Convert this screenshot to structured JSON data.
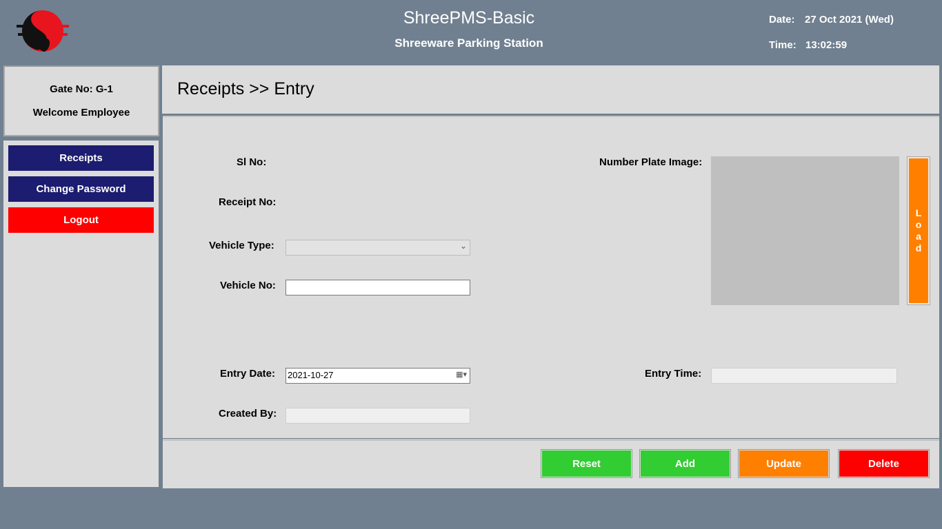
{
  "header": {
    "app_title": "ShreePMS-Basic",
    "subtitle": "Shreeware Parking Station",
    "date_label": "Date:",
    "date_value": "27 Oct 2021 (Wed)",
    "time_label": "Time:",
    "time_value": "13:02:59",
    "logo_icon": "shreeware-logo-icon"
  },
  "sidebar": {
    "gate_no": "Gate No: G-1",
    "welcome": "Welcome Employee",
    "items": [
      {
        "label": "Receipts",
        "color": "#1c1c70"
      },
      {
        "label": "Change Password",
        "color": "#1c1c70"
      },
      {
        "label": "Logout",
        "color": "#fe0000"
      }
    ]
  },
  "page": {
    "title": "Receipts >> Entry"
  },
  "form": {
    "sl_no_label": "Sl No:",
    "receipt_no_label": "Receipt No:",
    "vehicle_type_label": "Vehicle Type:",
    "vehicle_type_value": "",
    "vehicle_no_label": "Vehicle No:",
    "vehicle_no_value": "",
    "number_plate_label": "Number Plate Image:",
    "load_label": [
      "L",
      "o",
      "a",
      "d"
    ],
    "entry_date_label": "Entry Date:",
    "entry_date_value": "2021-10-27",
    "entry_time_label": "Entry Time:",
    "entry_time_value": "",
    "created_by_label": "Created By:",
    "created_by_value": ""
  },
  "actions": {
    "reset": "Reset",
    "add": "Add",
    "update": "Update",
    "delete": "Delete"
  },
  "colors": {
    "background": "#708090",
    "panel": "#dcdcdc",
    "navy": "#1c1c70",
    "red": "#fe0000",
    "green": "#32cd32",
    "orange": "#ff8000"
  }
}
